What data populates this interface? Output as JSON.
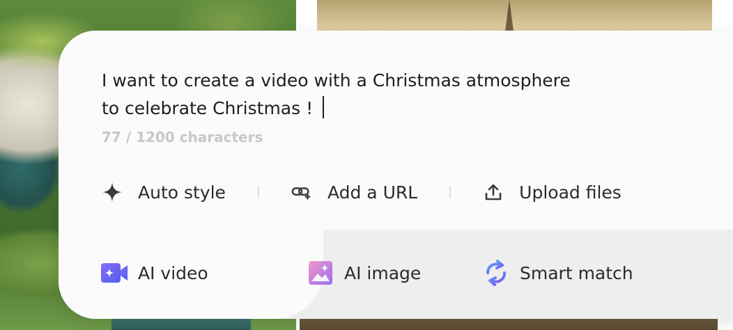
{
  "composer": {
    "prompt_line1": "I want to create a video with a Christmas atmosphere",
    "prompt_line2": "to celebrate Christmas !",
    "counter": "77 / 1200 characters"
  },
  "tools": [
    {
      "label": "Auto style",
      "icon": "sparkle-icon"
    },
    {
      "label": "Add a URL",
      "icon": "link-icon"
    },
    {
      "label": "Upload files",
      "icon": "upload-icon"
    }
  ],
  "tabs": [
    {
      "label": "AI video",
      "icon": "video-camera-icon",
      "active": true
    },
    {
      "label": "AI image",
      "icon": "image-icon",
      "active": false
    },
    {
      "label": "Smart match",
      "icon": "refresh-icon",
      "active": false
    }
  ],
  "colors": {
    "accent_purple": "#6b5cf0",
    "accent_pink": "#e86ab8",
    "accent_blue": "#5b7cf0",
    "text": "#2a2a30",
    "muted": "#c7c7cc"
  }
}
